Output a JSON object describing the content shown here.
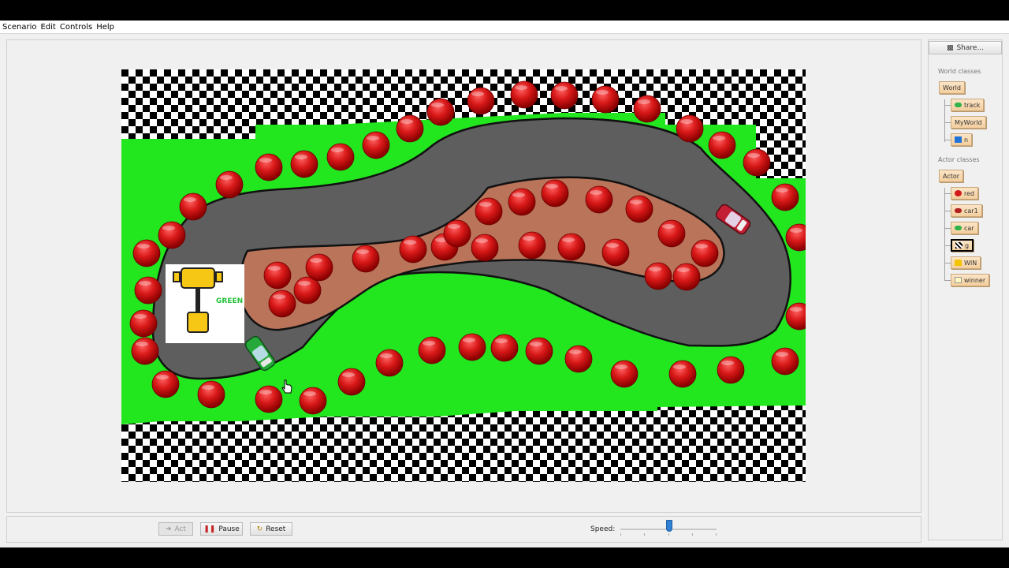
{
  "menu": [
    "Scenario",
    "Edit",
    "Controls",
    "Help"
  ],
  "share_label": "Share...",
  "world_classes_label": "World classes",
  "actor_classes_label": "Actor classes",
  "world_classes": [
    {
      "name": "World",
      "icon": "none",
      "color": ""
    },
    {
      "name": "track",
      "icon": "car-icon",
      "color": "#2fb34a"
    },
    {
      "name": "MyWorld",
      "icon": "none",
      "color": ""
    },
    {
      "name": "n",
      "icon": "blue-square-icon",
      "color": "#1e72d8"
    }
  ],
  "actor_classes": [
    {
      "name": "Actor",
      "icon": "none",
      "color": ""
    },
    {
      "name": "red",
      "icon": "red-ball-icon",
      "color": "#d11a1a"
    },
    {
      "name": "car1",
      "icon": "car-icon",
      "color": "#b02020"
    },
    {
      "name": "car",
      "icon": "car-icon",
      "color": "#2fb34a"
    },
    {
      "name": "g",
      "icon": "checker-icon",
      "color": "#000000"
    },
    {
      "name": "WIN",
      "icon": "trophy-icon",
      "color": "#f2c500"
    },
    {
      "name": "winner",
      "icon": "card-icon",
      "color": "#fff7c0"
    }
  ],
  "controls": {
    "act_label": "Act",
    "pause_label": "Pause",
    "reset_label": "Reset",
    "speed_label": "Speed:"
  },
  "world": {
    "trophy_text": "GREEN",
    "colors": {
      "grass": "#22e61e",
      "track": "#5e5e5e",
      "dirt": "#b9745a",
      "ball": "#d11a1a",
      "trophy": "#f6c714"
    }
  }
}
